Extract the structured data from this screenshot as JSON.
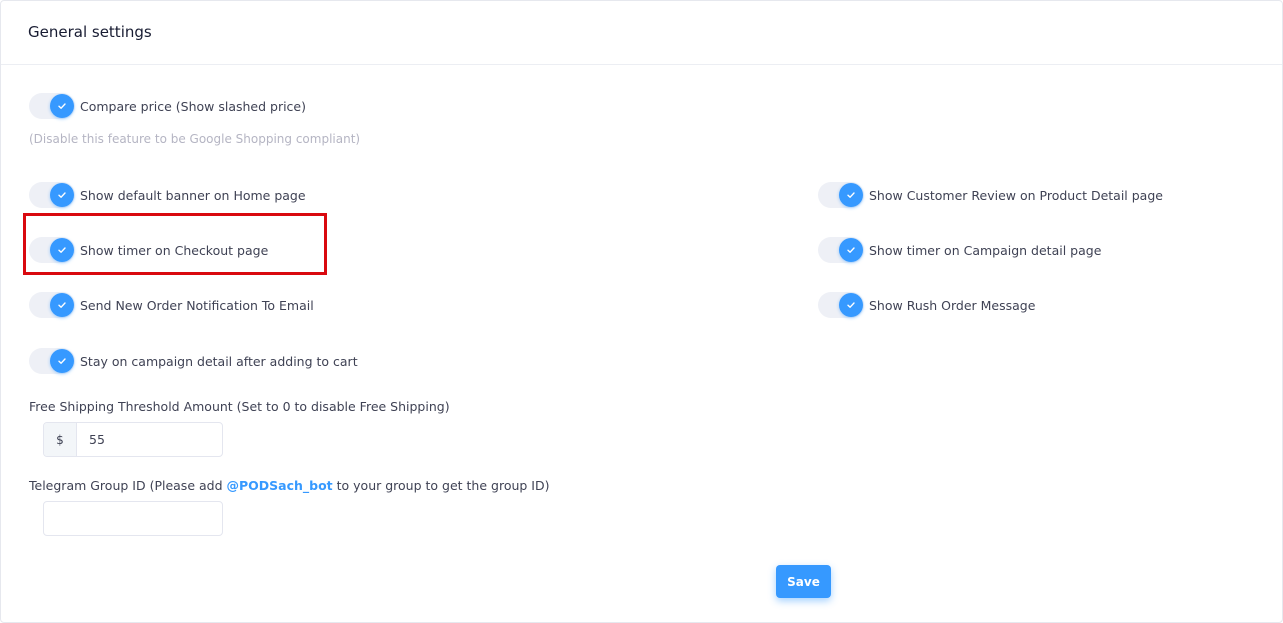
{
  "page": {
    "title": "General settings"
  },
  "toggles": {
    "compare_price": {
      "label": "Compare price (Show slashed price)",
      "checked": true
    },
    "compare_price_hint": "(Disable this feature to be Google Shopping compliant)",
    "default_banner": {
      "label": "Show default banner on Home page",
      "checked": true
    },
    "customer_review": {
      "label": "Show Customer Review on Product Detail page",
      "checked": true
    },
    "timer_checkout": {
      "label": "Show timer on Checkout page",
      "checked": true
    },
    "timer_campaign": {
      "label": "Show timer on Campaign detail page",
      "checked": true
    },
    "order_notification": {
      "label": "Send New Order Notification To Email",
      "checked": true
    },
    "rush_order": {
      "label": "Show Rush Order Message",
      "checked": true
    },
    "stay_on_campaign": {
      "label": "Stay on campaign detail after adding to cart",
      "checked": true
    }
  },
  "free_shipping": {
    "label": "Free Shipping Threshold Amount (Set to 0 to disable Free Shipping)",
    "currency_symbol": "$",
    "value": "55"
  },
  "telegram": {
    "label_prefix": "Telegram Group ID (Please add ",
    "bot_name": "@PODSach_bot",
    "label_suffix": " to your group to get the group ID)",
    "value": ""
  },
  "actions": {
    "save_label": "Save"
  },
  "colors": {
    "accent": "#3699ff",
    "highlight_border": "#d9090f",
    "toggle_track": "#eef0f6",
    "hint_text": "#b5b5c3"
  },
  "icons": {
    "toggle_knob": "check-icon"
  }
}
